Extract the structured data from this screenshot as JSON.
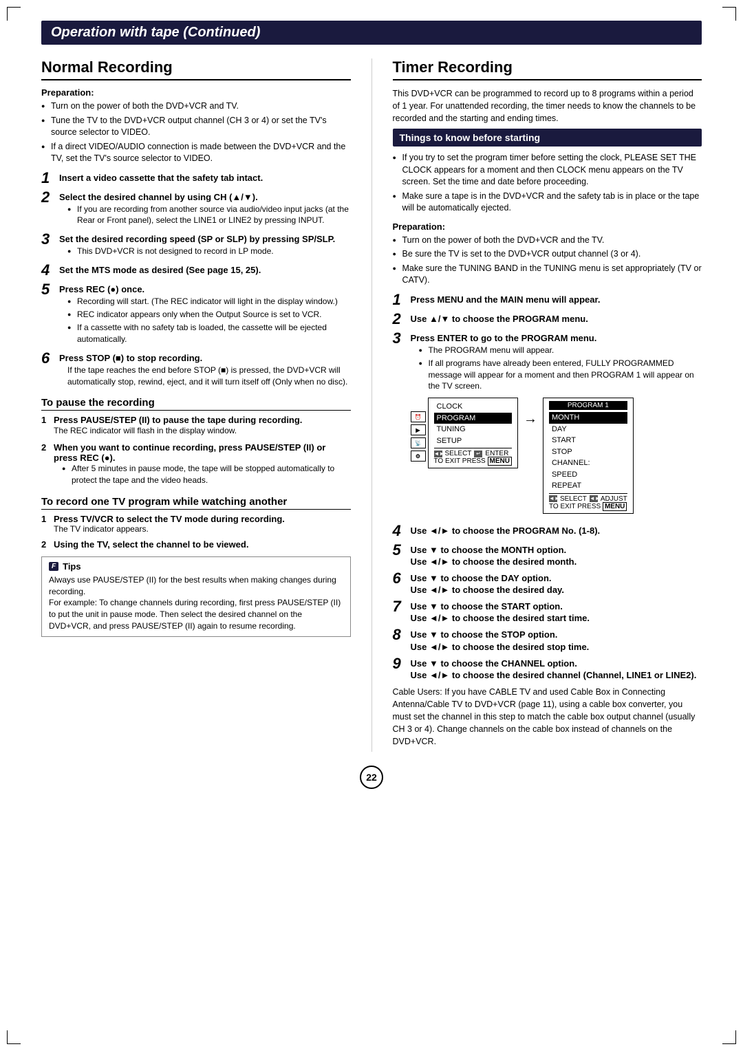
{
  "page": {
    "header": "Operation with tape (Continued)",
    "left_section": {
      "title": "Normal Recording",
      "preparation": {
        "heading": "Preparation:",
        "bullets": [
          "Turn on the power of both the DVD+VCR and TV.",
          "Tune the TV to the DVD+VCR output channel (CH 3 or 4) or set the TV's source selector to VIDEO.",
          "If a direct VIDEO/AUDIO connection is made between the DVD+VCR and the TV, set the TV's source selector to VIDEO."
        ]
      },
      "steps": [
        {
          "number": "1",
          "title": "Insert a video cassette that the safety tab intact.",
          "sub": []
        },
        {
          "number": "2",
          "title": "Select the desired channel by using CH (▲/▼).",
          "sub": [
            "If you are recording from another source via audio/video input jacks (at the Rear or Front panel), select the LINE1 or LINE2 by pressing INPUT."
          ]
        },
        {
          "number": "3",
          "title": "Set the desired recording speed (SP or SLP) by pressing SP/SLP.",
          "sub": [
            "This DVD+VCR is not designed to record in LP mode."
          ]
        },
        {
          "number": "4",
          "title": "Set the MTS mode as desired (See page 15, 25).",
          "sub": []
        },
        {
          "number": "5",
          "title": "Press REC (●) once.",
          "sub": [
            "Recording will start. (The REC indicator will light in the display window.)",
            "REC indicator appears only when the Output Source is set to VCR.",
            "If a cassette with no safety tab is loaded, the cassette will be ejected automatically."
          ]
        },
        {
          "number": "6",
          "title": "Press STOP (■) to stop recording.",
          "sub_text": "If the tape reaches the end before STOP (■) is pressed, the DVD+VCR will automatically stop, rewind, eject, and it will turn itself off (Only when no disc)."
        }
      ],
      "pause_section": {
        "title": "To pause the recording",
        "items": [
          {
            "num": "1",
            "text": "Press PAUSE/STEP (II) to pause the tape during recording.",
            "sub": "The REC indicator will flash in the display window."
          },
          {
            "num": "2",
            "text": "When you want to continue recording, press PAUSE/STEP (II) or press REC (●).",
            "sub": "After 5 minutes in pause mode, the tape will be stopped automatically to protect the tape and the video heads."
          }
        ]
      },
      "watch_section": {
        "title": "To record one TV program while watching another",
        "items": [
          {
            "num": "1",
            "text": "Press TV/VCR to select the TV mode during recording.",
            "sub": "The TV indicator appears."
          },
          {
            "num": "2",
            "text": "Using the TV, select the channel to be viewed.",
            "sub": ""
          }
        ]
      },
      "tips": {
        "heading": "Tips",
        "text": "Always use PAUSE/STEP (II) for the best results when making changes during recording.\nFor example: To change channels during recording, first press PAUSE/STEP (II) to put the unit in pause mode. Then select the desired channel on the DVD+VCR, and press PAUSE/STEP (II) again to resume recording."
      }
    },
    "right_section": {
      "title": "Timer Recording",
      "intro": "This DVD+VCR can be programmed to record up to 8 programs within a period of 1 year. For unattended recording, the timer needs to know the channels to be recorded and the starting and ending times.",
      "know_box": "Things to know before starting",
      "know_bullets": [
        "If you try to set the program timer before setting the clock, PLEASE SET THE CLOCK appears for a moment and then CLOCK menu appears on the TV screen. Set the time and date before proceeding.",
        "Make sure a tape is in the DVD+VCR and the safety tab is in place or the tape will be automatically ejected."
      ],
      "preparation": {
        "heading": "Preparation:",
        "bullets": [
          "Turn on the power of both the DVD+VCR and the TV.",
          "Be sure the TV is set to the DVD+VCR output channel (3 or 4).",
          "Make sure the TUNING BAND in the TUNING menu is set appropriately (TV or CATV)."
        ]
      },
      "steps": [
        {
          "number": "1",
          "title": "Press MENU and the MAIN menu will appear.",
          "sub": []
        },
        {
          "number": "2",
          "title": "Use ▲/▼ to choose the PROGRAM menu.",
          "sub": []
        },
        {
          "number": "3",
          "title": "Press ENTER to go to the PROGRAM menu.",
          "sub": [
            "The PROGRAM menu will appear.",
            "If all programs have already been entered, FULLY PROGRAMMED message will appear for a moment and then PROGRAM 1 will appear on the TV screen."
          ]
        },
        {
          "number": "4",
          "title": "Use ◄/► to choose the PROGRAM No. (1-8).",
          "sub": []
        },
        {
          "number": "5",
          "title": "Use ▼ to choose the MONTH option.",
          "sub_title2": "Use ◄/► to choose the desired month.",
          "sub": []
        },
        {
          "number": "6",
          "title": "Use ▼ to choose the DAY option.",
          "sub_title2": "Use ◄/► to choose the desired day.",
          "sub": []
        },
        {
          "number": "7",
          "title": "Use ▼ to choose the START option.",
          "sub_title2": "Use ◄/► to choose the desired start time.",
          "sub": []
        },
        {
          "number": "8",
          "title": "Use ▼ to choose the STOP option.",
          "sub_title2": "Use ◄/► to choose the desired stop time.",
          "sub": []
        },
        {
          "number": "9",
          "title": "Use ▼ to choose the CHANNEL option.",
          "sub_title2": "Use ◄/► to choose the desired channel (Channel, LINE1 or LINE2).",
          "sub": []
        }
      ],
      "cable_note": "Cable Users: If you have CABLE TV and used Cable Box in Connecting Antenna/Cable TV to DVD+VCR (page 11), using a cable box converter, you must set the channel in this step to match the cable box output channel (usually CH 3 or 4). Change channels on the cable box instead of channels on the DVD+VCR.",
      "menu_left": {
        "title": "",
        "items": [
          "CLOCK",
          "PROGRAM",
          "TUNING",
          "SETUP"
        ],
        "footer": "SELECT  ENTER\nTO EXIT PRESS MENU"
      },
      "menu_right": {
        "title": "PROGRAM 1",
        "items": [
          "MONTH",
          "DAY",
          "START",
          "STOP",
          "CHANNEL:",
          "SPEED",
          "REPEAT"
        ],
        "footer": "SELECT  ADJUST\nTO EXIT PRESS MENU"
      }
    },
    "page_number": "22"
  }
}
